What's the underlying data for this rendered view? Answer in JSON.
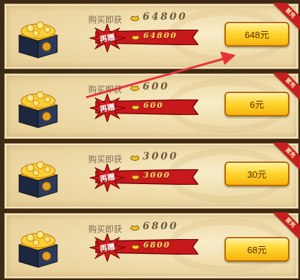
{
  "packs": [
    {
      "buy_label": "购买即获",
      "buy_amount": "64800",
      "bonus_label": "再赠",
      "bonus_amount": "64800",
      "price": "648元",
      "badge": "首充"
    },
    {
      "buy_label": "购买即获",
      "buy_amount": "600",
      "bonus_label": "再赠",
      "bonus_amount": "600",
      "price": "6元",
      "badge": "首充"
    },
    {
      "buy_label": "购买即获",
      "buy_amount": "3000",
      "bonus_label": "再赠",
      "bonus_amount": "3000",
      "price": "30元",
      "badge": "首充"
    },
    {
      "buy_label": "购买即获",
      "buy_amount": "6800",
      "bonus_label": "再赠",
      "bonus_amount": "6800",
      "price": "68元",
      "badge": "首充"
    }
  ],
  "colors": {
    "accent_red": "#c81e1e",
    "button_yellow": "#ffd632",
    "arrow": "#e8323a"
  },
  "icons": {
    "currency": "gold-ingot-icon",
    "chest": "treasure-chest-icon",
    "arrow": "red-pointer-arrow"
  }
}
